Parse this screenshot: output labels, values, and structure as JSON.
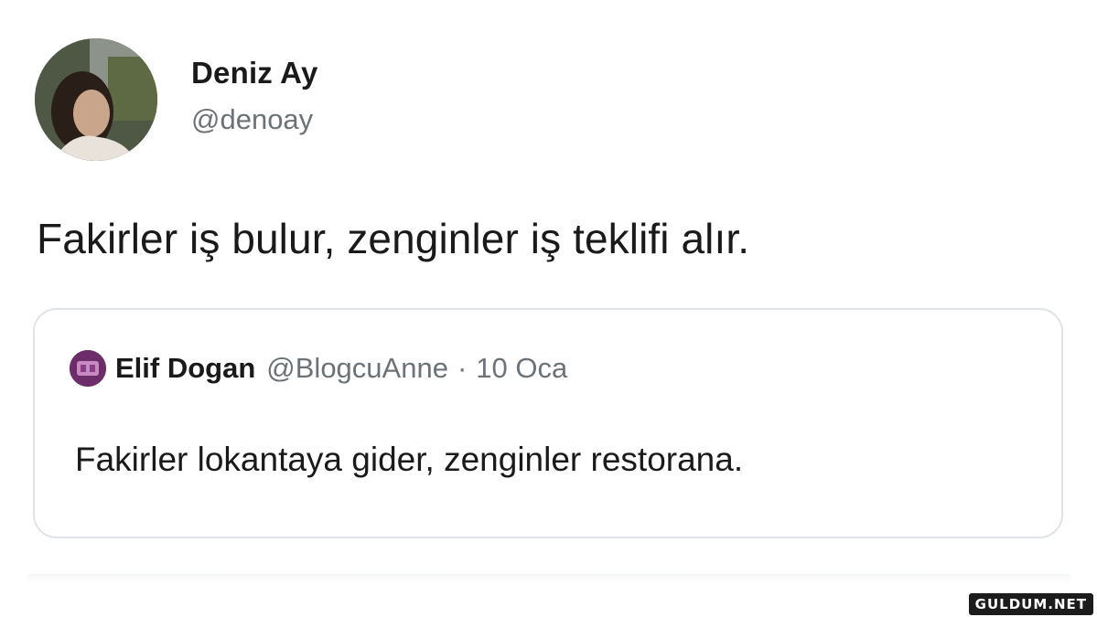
{
  "tweet": {
    "author": {
      "display_name": "Deniz Ay",
      "handle": "@denoay"
    },
    "text": "Fakirler iş bulur, zenginler iş teklifi alır."
  },
  "quoted_tweet": {
    "author": {
      "display_name": "Elif Dogan",
      "handle": "@BlogcuAnne",
      "avatar_color": "#6d2c6a"
    },
    "separator": "·",
    "timestamp": "10 Oca",
    "text": "Fakirler lokantaya gider, zenginler restorana."
  },
  "watermark": {
    "text": "GULDUM.NET"
  },
  "colors": {
    "text_primary": "#1a1a1a",
    "text_secondary": "#6b7278",
    "card_border": "#dfe3e7",
    "background": "#ffffff"
  }
}
